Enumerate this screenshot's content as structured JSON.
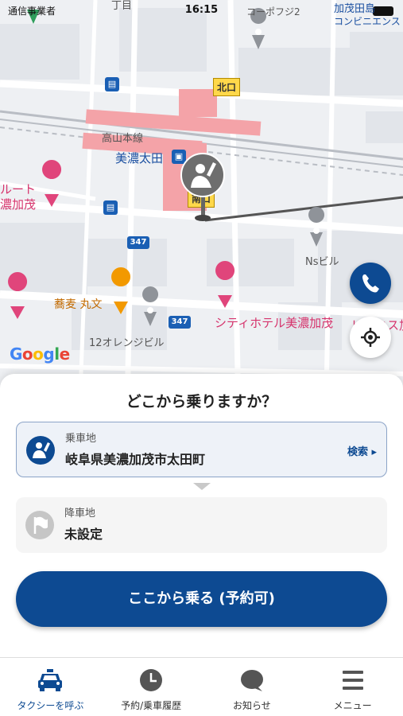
{
  "status_bar": {
    "carrier": "通信事業者",
    "time": "16:15"
  },
  "map": {
    "labels": {
      "top_partial": "丁目",
      "corpo": "コーポフジ2",
      "store_name": "加茂田島",
      "store_sub": "コンビニエンス",
      "north_exit": "北口",
      "line_name": "高山本線",
      "station": "美濃太田",
      "south_exit": "南口",
      "left_route": "ルート",
      "left_mino": "濃加茂",
      "route_347_a": "347",
      "route_347_b": "347",
      "ns_building": "Nsビル",
      "soba": "蕎麦 丸文",
      "orange": "12オレンジビル",
      "hotel": "シティホテル美濃加茂",
      "right_partial": "ビジネス加",
      "google": "Google"
    },
    "icons": {
      "phone": "phone-icon",
      "locate": "crosshair-icon",
      "pin": "hand-raise-icon"
    }
  },
  "sheet": {
    "title": "どこから乗りますか？",
    "pickup": {
      "label": "乗車地",
      "value": "岐阜県美濃加茂市太田町",
      "search": "検索 ▸"
    },
    "dropoff": {
      "label": "降車地",
      "value": "未設定"
    },
    "ride_button": "ここから乗る (予約可)"
  },
  "tabbar": {
    "tabs": [
      {
        "label": "タクシーを呼ぶ",
        "icon": "taxi-icon",
        "active": true
      },
      {
        "label": "予約/乗車履歴",
        "icon": "clock-icon",
        "active": false
      },
      {
        "label": "お知らせ",
        "icon": "chat-bubble-icon",
        "active": false
      },
      {
        "label": "メニュー",
        "icon": "hamburger-icon",
        "active": false
      }
    ]
  },
  "colors": {
    "primary": "#0d4a92",
    "station_pink": "#f4a3a8",
    "map_bg": "#eef0f3"
  }
}
